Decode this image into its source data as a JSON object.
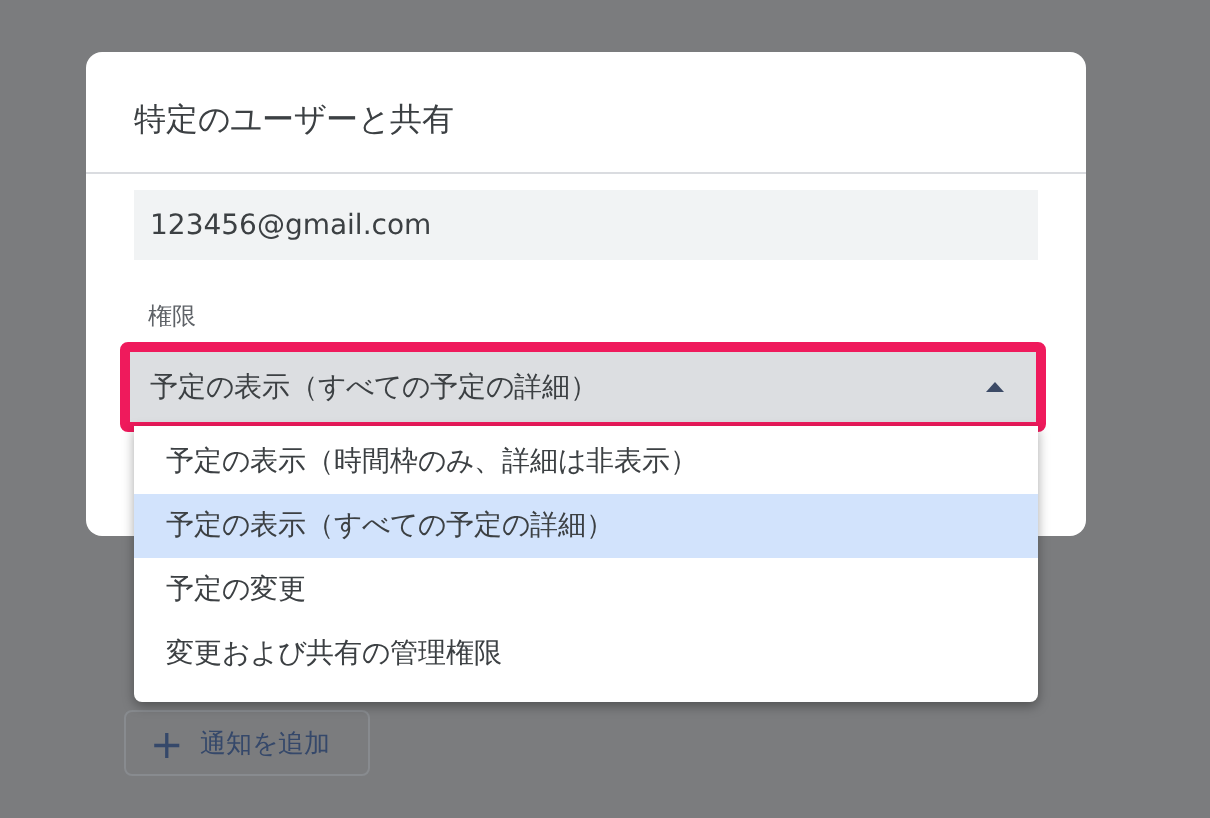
{
  "background": {
    "add_notification_button": {
      "label": "通知を追加",
      "icon": "+"
    }
  },
  "dialog": {
    "title": "特定のユーザーと共有",
    "email": {
      "value": "123456@gmail.com"
    },
    "permission": {
      "label": "権限",
      "value": "予定の表示（すべての予定の詳細）",
      "highlighted": true,
      "expanded": true
    }
  },
  "menu": {
    "items": [
      {
        "label": "予定の表示（時間枠のみ、詳細は非表示）",
        "selected": false
      },
      {
        "label": "予定の表示（すべての予定の詳細）",
        "selected": true
      },
      {
        "label": "予定の変更",
        "selected": false
      },
      {
        "label": "変更および共有の管理権限",
        "selected": false
      }
    ]
  }
}
